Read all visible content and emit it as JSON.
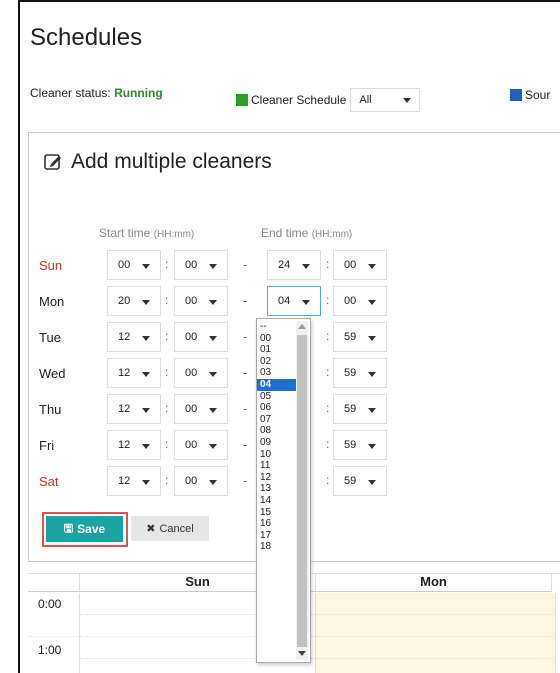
{
  "page": {
    "title": "Schedules"
  },
  "status": {
    "label": "Cleaner status:",
    "value": "Running"
  },
  "legend": {
    "cleaner": {
      "label": "Cleaner Schedule",
      "color": "#2ca02c",
      "filter_value": "All"
    },
    "source": {
      "label": "Sour",
      "color": "#1f5fbf"
    }
  },
  "panel": {
    "title": "Add multiple cleaners",
    "start_head": "Start time",
    "end_head": "End time",
    "format_hint": "(HH:mm)"
  },
  "rows": [
    {
      "day": "Sun",
      "weekend": true,
      "sh": "00",
      "sm": "00",
      "eh": "24",
      "em": "00"
    },
    {
      "day": "Mon",
      "weekend": false,
      "sh": "20",
      "sm": "00",
      "eh": "04",
      "em": "00"
    },
    {
      "day": "Tue",
      "weekend": false,
      "sh": "12",
      "sm": "00",
      "eh": "",
      "em": "59"
    },
    {
      "day": "Wed",
      "weekend": false,
      "sh": "12",
      "sm": "00",
      "eh": "",
      "em": "59"
    },
    {
      "day": "Thu",
      "weekend": false,
      "sh": "12",
      "sm": "00",
      "eh": "",
      "em": "59"
    },
    {
      "day": "Fri",
      "weekend": false,
      "sh": "12",
      "sm": "00",
      "eh": "",
      "em": "59"
    },
    {
      "day": "Sat",
      "weekend": true,
      "sh": "12",
      "sm": "00",
      "eh": "",
      "em": "59"
    }
  ],
  "separators": {
    "colon": ":",
    "dash": "-"
  },
  "buttons": {
    "save": "Save",
    "cancel": "Cancel"
  },
  "dropdown": {
    "options": [
      "--",
      "00",
      "01",
      "02",
      "03",
      "04",
      "05",
      "06",
      "07",
      "08",
      "09",
      "10",
      "11",
      "12",
      "13",
      "14",
      "15",
      "16",
      "17",
      "18"
    ],
    "selected": "04"
  },
  "grid": {
    "columns": [
      "Sun",
      "Mon"
    ],
    "times": [
      "0:00",
      "1:00"
    ]
  }
}
